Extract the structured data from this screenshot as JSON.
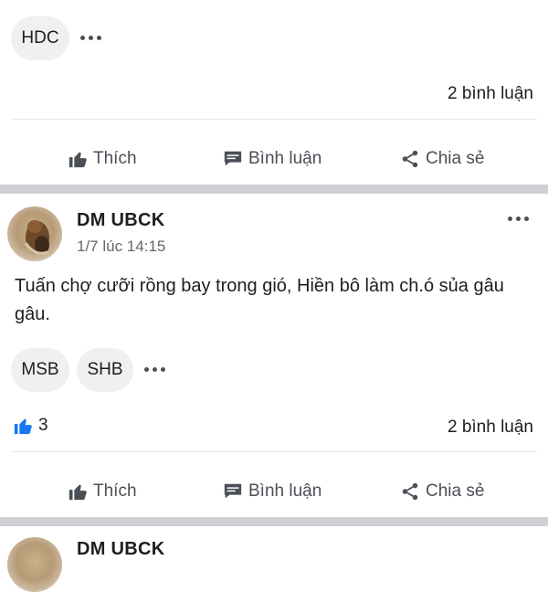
{
  "post1": {
    "chips": [
      "HDC"
    ],
    "comments": "2 bình luận"
  },
  "actions": {
    "like": "Thích",
    "comment": "Bình luận",
    "share": "Chia sẻ"
  },
  "post2": {
    "author": "DM UBCK",
    "time": "1/7 lúc 14:15",
    "text": "Tuấn chợ cưỡi rồng bay trong gió, Hiền bô làm ch.ó sủa gâu gâu.",
    "chips": [
      "MSB",
      "SHB"
    ],
    "like_count": "3",
    "comments": "2 bình luận"
  },
  "post3": {
    "author": "DM UBCK"
  },
  "colors": {
    "like_blue": "#1877f2",
    "separator": "#cfd1d4",
    "chip_bg": "#f0f0f2"
  }
}
